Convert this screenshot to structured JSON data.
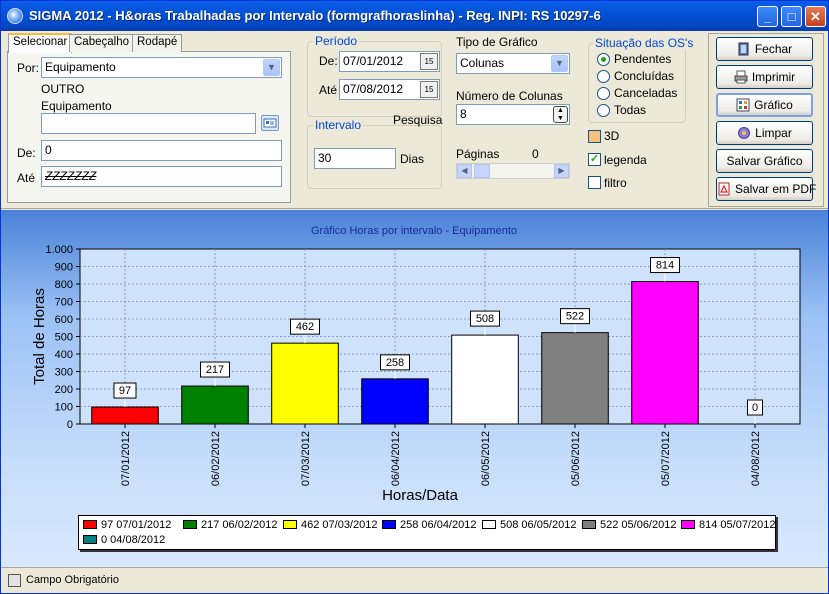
{
  "window": {
    "title": "SIGMA 2012 - H&oras Trabalhadas por Intervalo  (formgrafhoraslinha)  - Reg. INPI: RS 10297-6"
  },
  "tabs": [
    "Selecionar",
    "Cabeçalho",
    "Rodapé"
  ],
  "selecionar": {
    "por_label": "Por:",
    "por_value": "Equipamento",
    "outro_label": "OUTRO",
    "equipamento_label": "Equipamento",
    "equipamento_value": "",
    "de_label": "De:",
    "de_value": "0",
    "ate_label": "Até",
    "ate_value": "ZZZZZZZ"
  },
  "periodo": {
    "title": "Período",
    "de_label": "De:",
    "de_value": "07/01/2012",
    "ate_label": "Até",
    "ate_value": "07/08/2012",
    "cal_glyph": "15"
  },
  "intervalo": {
    "title": "Intervalo",
    "pesquisa_label": "Pesquisa",
    "value": "30",
    "unit": "Dias"
  },
  "tipo": {
    "title": "Tipo de Gráfico",
    "value": "Colunas",
    "num_colunas_label": "Número de Colunas",
    "num_colunas_value": "8",
    "paginas_label": "Páginas",
    "paginas_value": "0"
  },
  "situacao": {
    "title": "Situação das OS's",
    "options": [
      "Pendentes",
      "Concluídas",
      "Canceladas",
      "Todas"
    ],
    "selected": "Pendentes"
  },
  "options": {
    "3d_label": "3D",
    "legenda_label": "legenda",
    "filtro_label": "filtro"
  },
  "buttons": {
    "fechar": "Fechar",
    "imprimir": "Imprimir",
    "grafico": "Gráfico",
    "limpar": "Limpar",
    "salvar_grafico": "Salvar Gráfico",
    "salvar_pdf": "Salvar em PDF"
  },
  "status": {
    "campo_obrigatorio": "Campo Obrigatório"
  },
  "chart_data": {
    "type": "bar",
    "title": "Gráfico Horas por intervalo - Equipamento",
    "xlabel": "Horas/Data",
    "ylabel": "Total de Horas",
    "ylim": [
      0,
      1000
    ],
    "yticks": [
      "0",
      "100",
      "200",
      "300",
      "400",
      "500",
      "600",
      "700",
      "800",
      "900",
      "1.000"
    ],
    "categories": [
      "07/01/2012",
      "06/02/2012",
      "07/03/2012",
      "06/04/2012",
      "06/05/2012",
      "05/06/2012",
      "05/07/2012",
      "04/08/2012"
    ],
    "values": [
      97,
      217,
      462,
      258,
      508,
      522,
      814,
      0
    ],
    "colors": [
      "#ff0000",
      "#008000",
      "#ffff00",
      "#0000ff",
      "#ffffff",
      "#808080",
      "#ff00ff",
      "#008080"
    ],
    "legend": [
      "97 07/01/2012",
      "217 06/02/2012",
      "462 07/03/2012",
      "258 06/04/2012",
      "508 06/05/2012",
      "522 05/06/2012",
      "814 05/07/2012",
      "0 04/08/2012"
    ],
    "grid": true,
    "legend_position": "bottom"
  }
}
